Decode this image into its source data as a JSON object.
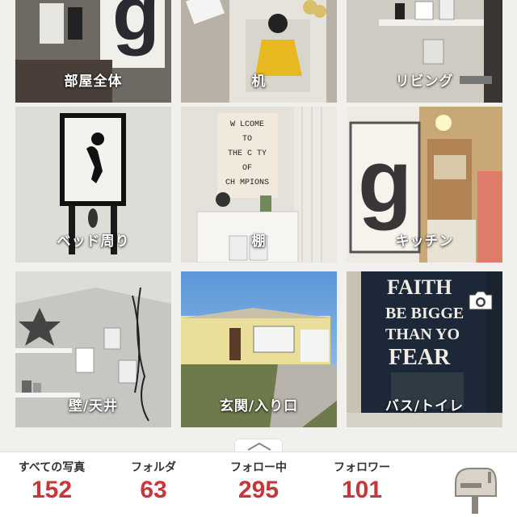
{
  "folders": [
    {
      "label": "部屋全体"
    },
    {
      "label": "机"
    },
    {
      "label": "リビング"
    },
    {
      "label": "ベッド周り"
    },
    {
      "label": "棚"
    },
    {
      "label": "キッチン"
    },
    {
      "label": "壁/天井"
    },
    {
      "label": "玄関/入り口"
    },
    {
      "label": "バス/トイレ"
    }
  ],
  "stats": {
    "all_photos": {
      "label": "すべての写真",
      "value": "152"
    },
    "folders": {
      "label": "フォルダ",
      "value": "63"
    },
    "following": {
      "label": "フォロー中",
      "value": "295"
    },
    "followers": {
      "label": "フォロワー",
      "value": "101"
    }
  },
  "photo_text": {
    "poster_g": "g",
    "letterboard_1": "W LCOME",
    "letterboard_2": "TO",
    "letterboard_3": "THE C TY",
    "letterboard_4": "OF",
    "letterboard_5": "CH MPIONS",
    "faith_1": "FAITH",
    "faith_2": "BE BIGGE",
    "faith_3": "THAN YO",
    "faith_4": "FEAR"
  },
  "colors": {
    "accent": "#c8363a",
    "background": "#f2f0ec"
  },
  "icons": {
    "camera": "camera-icon",
    "mailbox": "mailbox-icon",
    "expand": "chevron-up-icon"
  }
}
